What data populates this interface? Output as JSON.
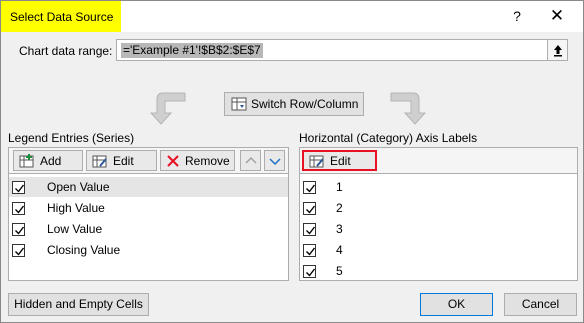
{
  "dialog": {
    "title": "Select Data Source",
    "help_glyph": "?",
    "close_glyph": "✕"
  },
  "range": {
    "label": "Chart data range:",
    "value": "='Example #1'!$B$2:$E$7"
  },
  "switch": {
    "label": "Switch Row/Column"
  },
  "legend": {
    "label": "Legend Entries (Series)",
    "add_label": "Add",
    "edit_label": "Edit",
    "remove_label": "Remove",
    "series": [
      {
        "name": "Open Value",
        "checked": true
      },
      {
        "name": "High Value",
        "checked": true
      },
      {
        "name": "Low Value",
        "checked": true
      },
      {
        "name": "Closing Value",
        "checked": true
      }
    ]
  },
  "axis": {
    "label": "Horizontal (Category) Axis Labels",
    "edit_label": "Edit",
    "highlight_color": "#e81123",
    "items": [
      {
        "name": "1",
        "checked": true
      },
      {
        "name": "2",
        "checked": true
      },
      {
        "name": "3",
        "checked": true
      },
      {
        "name": "4",
        "checked": true
      },
      {
        "name": "5",
        "checked": true
      }
    ]
  },
  "footer": {
    "hidden_label": "Hidden and Empty Cells",
    "ok_label": "OK",
    "cancel_label": "Cancel"
  }
}
